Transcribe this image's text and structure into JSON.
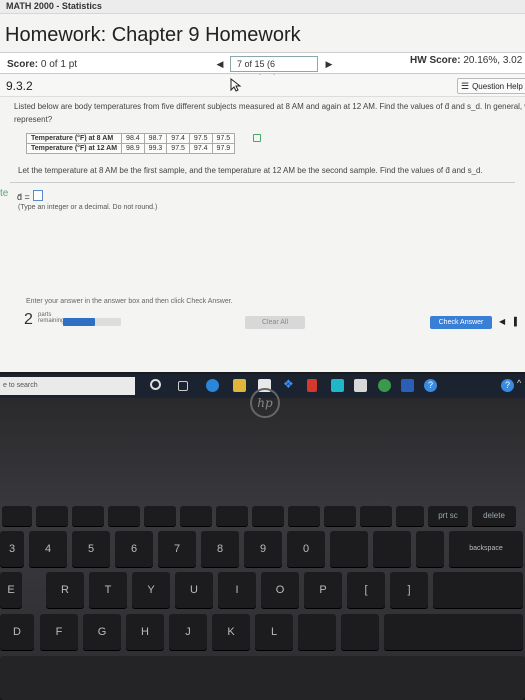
{
  "course": {
    "title": "MATH 2000 - Statistics"
  },
  "page": {
    "title": "Homework: Chapter 9 Homework"
  },
  "score_bar": {
    "score_label": "Score:",
    "score_value": "0 of 1 pt",
    "progress_text": "7 of 15 (6 complete)",
    "hw_score_label": "HW Score:",
    "hw_score_value": "20.16%, 3.02 o"
  },
  "question": {
    "number": "9.3.2",
    "help_label": "Question Help",
    "line1": "Listed below are body temperatures from five different subjects measured at 8 AM and again at 12 AM. Find the values of d̄ and s_d. In general, what does μ_d",
    "line2": "represent?",
    "table": {
      "rows": [
        {
          "label": "Temperature (°F) at 8 AM",
          "values": [
            "98.4",
            "98.7",
            "97.4",
            "97.5",
            "97.5"
          ]
        },
        {
          "label": "Temperature (°F) at 12 AM",
          "values": [
            "98.9",
            "99.3",
            "97.5",
            "97.4",
            "97.9"
          ]
        }
      ]
    },
    "line3": "Let the temperature at 8 AM be the first sample, and the temperature at 12 AM be the second sample. Find the values of d̄ and s_d.",
    "te_fragment": "te",
    "answer_label": "d̄ =",
    "answer_value": "",
    "hint": "(Type an integer or a decimal. Do not round.)"
  },
  "footer": {
    "instruction": "Enter your answer in the answer box and then click Check Answer.",
    "parts_count": "2",
    "parts_label": "parts remaining",
    "parts_progress": 0.55,
    "clear_all": "Clear All",
    "check_answer": "Check Answer"
  },
  "taskbar": {
    "search_placeholder": "e to search"
  },
  "laptop": {
    "logo": "hp"
  },
  "keyboard": {
    "fn_keys": [
      "",
      "",
      "",
      "",
      "",
      "",
      "",
      "",
      "",
      "",
      "",
      "",
      "prt sc",
      "delete"
    ],
    "num_keys": [
      "3",
      "4",
      "5",
      "6",
      "7",
      "8",
      "9",
      "0",
      "",
      "",
      "",
      "backspace"
    ],
    "row_q": [
      "E",
      "R",
      "T",
      "Y",
      "U",
      "I",
      "O",
      "P",
      "[",
      "]"
    ],
    "row_a": [
      "D",
      "F",
      "G",
      "H",
      "J",
      "K",
      "L",
      "",
      ""
    ]
  },
  "colors": {
    "accent": "#3a7fd6",
    "progress_fill": "#2d6fc5"
  }
}
